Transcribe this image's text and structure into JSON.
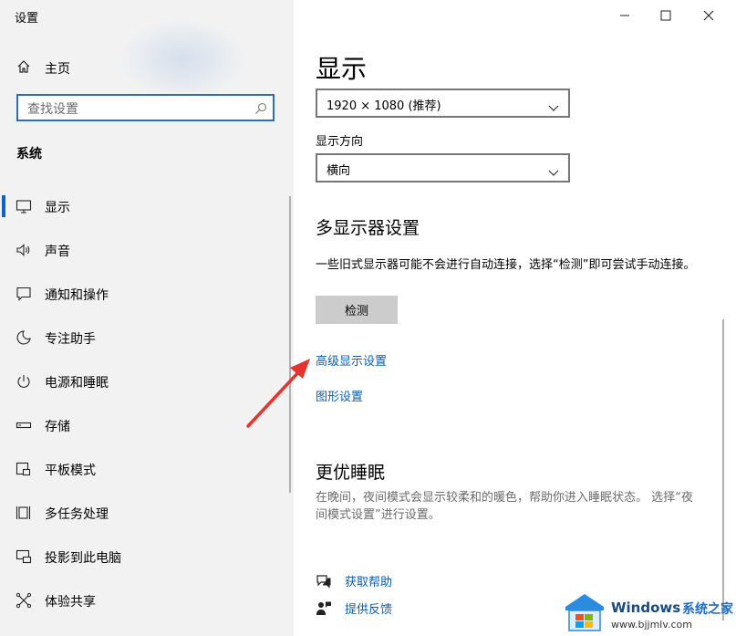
{
  "window": {
    "title": "设置"
  },
  "sidebar": {
    "home_label": "主页",
    "search_placeholder": "查找设置",
    "section_title": "系统",
    "items": [
      {
        "label": "显示",
        "icon": "monitor-icon",
        "active": true
      },
      {
        "label": "声音",
        "icon": "speaker-icon"
      },
      {
        "label": "通知和操作",
        "icon": "notification-icon"
      },
      {
        "label": "专注助手",
        "icon": "moon-icon"
      },
      {
        "label": "电源和睡眠",
        "icon": "power-icon"
      },
      {
        "label": "存储",
        "icon": "storage-icon"
      },
      {
        "label": "平板模式",
        "icon": "tablet-icon"
      },
      {
        "label": "多任务处理",
        "icon": "multitask-icon"
      },
      {
        "label": "投影到此电脑",
        "icon": "project-icon"
      },
      {
        "label": "体验共享",
        "icon": "share-icon"
      }
    ]
  },
  "main": {
    "title": "显示",
    "resolution": "1920 × 1080 (推荐)",
    "orientation_label": "显示方向",
    "orientation": "横向",
    "multi_display_title": "多显示器设置",
    "multi_display_desc": "一些旧式显示器可能不会进行自动连接，选择“检测”即可尝试手动连接。",
    "detect_button": "检测",
    "advanced_link": "高级显示设置",
    "graphics_link": "图形设置",
    "sleep_title": "更优睡眠",
    "sleep_desc": "在晚间，夜间模式会显示较柔和的暖色，帮助你进入睡眠状态。 选择“夜间模式设置”进行设置。",
    "get_help": "获取帮助",
    "feedback": "提供反馈"
  },
  "watermark": {
    "brand": "Windows",
    "site": "系统之家",
    "url": "www.bjjmlv.com"
  },
  "colors": {
    "accent": "#0a64c8",
    "link": "#0a5eb3",
    "annotation_arrow": "#e8322e"
  }
}
